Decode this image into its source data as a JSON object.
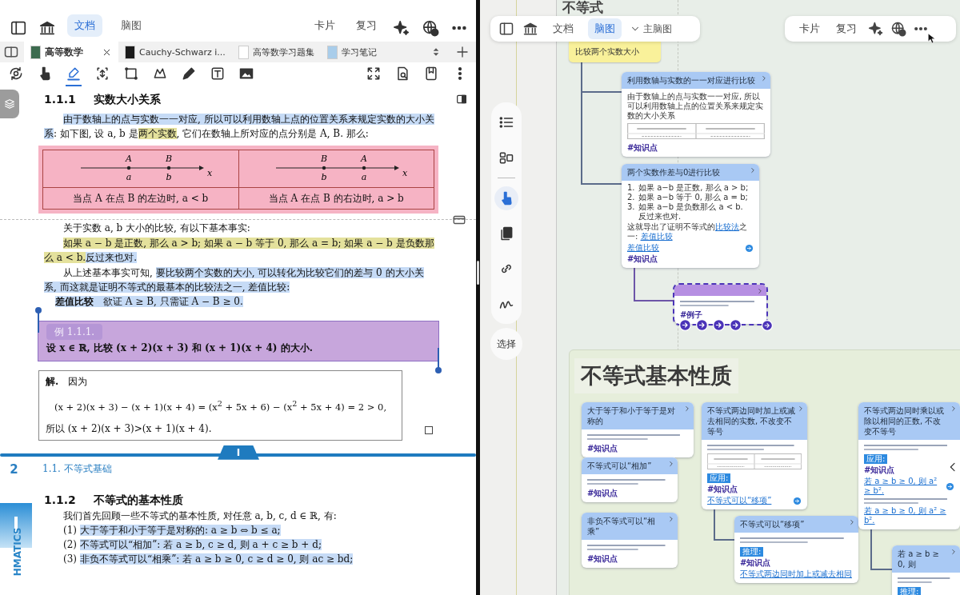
{
  "document_pane": {
    "toolbar": {
      "view_tabs": [
        {
          "label": "文档",
          "selected": true
        },
        {
          "label": "脑图",
          "selected": false
        }
      ],
      "actions": [
        {
          "label": "卡片"
        },
        {
          "label": "复习"
        }
      ]
    },
    "tabs": [
      {
        "label": "高等数学",
        "selected": true,
        "color": "#3d6b4f"
      },
      {
        "label": "Cauchy-Schwarz i...",
        "selected": false,
        "color": "#1a1a1a"
      },
      {
        "label": "高等数学习题集",
        "selected": false,
        "color": "#ffffff"
      },
      {
        "label": "学习笔记",
        "selected": false,
        "color": "#a9cdea"
      }
    ],
    "tools": [
      {
        "kind": "rotate",
        "selected": false
      },
      {
        "kind": "hand",
        "selected": false
      },
      {
        "kind": "highlighter",
        "selected": true
      },
      {
        "kind": "resize",
        "selected": false
      },
      {
        "kind": "rectangle",
        "selected": false
      },
      {
        "kind": "lasso",
        "selected": false
      },
      {
        "kind": "pencil",
        "selected": false
      },
      {
        "kind": "textbox",
        "selected": false
      },
      {
        "kind": "image",
        "selected": false
      },
      {
        "kind": "expand",
        "selected": false
      },
      {
        "kind": "doc_search",
        "selected": false
      },
      {
        "kind": "bookmark",
        "selected": false
      },
      {
        "kind": "more",
        "selected": false
      }
    ],
    "page": {
      "blocks": [
        {
          "kind": "heading",
          "number": "1.1.1",
          "text": "实数大小关系"
        },
        {
          "kind": "paragraph",
          "segments": [
            {
              "text": "由于数轴上的点与实数一一对应, 所以可以利用数轴上点的位置关系来规定实数的大小关系",
              "highlighted": true,
              "color": "#c6dbf6"
            },
            {
              "text": ": 如下图, 设 a, b 是",
              "highlighted": false
            },
            {
              "text": "两个实数",
              "highlighted": true,
              "color": "#e4e19c"
            },
            {
              "text": ", 它们在数轴上所对应的点分别是 A, B. 那么:",
              "highlighted": false
            }
          ]
        },
        {
          "kind": "figure",
          "highlighted": true,
          "color": "#f6b3c4",
          "cells": [
            {
              "top_labels": [
                "A",
                "B"
              ],
              "bottom_labels": [
                "a",
                "b"
              ],
              "axis_label": "x",
              "caption": "当点 A 在点 B 的左边时, a < b"
            },
            {
              "top_labels": [
                "B",
                "A"
              ],
              "bottom_labels": [
                "b",
                "a"
              ],
              "axis_label": "x",
              "caption": "当点 A 在点 B 的右边时, a > b"
            }
          ]
        },
        {
          "kind": "paragraph",
          "segments": [
            {
              "text": "关于实数 a, b 大小的比较, 有以下基本事实:",
              "highlighted": false
            }
          ]
        },
        {
          "kind": "paragraph",
          "segments": [
            {
              "text": "如果 a − b 是正数, 那么 a > b; 如果 a − b 等于 0, 那么 a = b; 如果 a − b 是负数那么 a < b.",
              "highlighted": true,
              "color": "#e4e19c"
            },
            {
              "text": "反过来也对.",
              "highlighted": true,
              "color": "#c6dbf6"
            }
          ]
        },
        {
          "kind": "paragraph",
          "segments": [
            {
              "text": "从上述基本事实可知, ",
              "highlighted": false
            },
            {
              "text": "要比较两个实数的大小, 可以转化为比较它们的差与 0 的大小关系, 而这就是证明不等式的最基本的比较法之一, 差值比较:",
              "highlighted": true,
              "color": "#c6dbf6"
            }
          ]
        },
        {
          "kind": "definition",
          "segments": [
            {
              "text": "**差值比较**　欲证 A ≥ B, 只需证 A − B ≥ 0.",
              "highlighted": true,
              "color": "#c6dbf6"
            }
          ]
        },
        {
          "kind": "example",
          "highlighted": true,
          "color": "#c7a6dc",
          "selected": true,
          "label": "例 1.1.1.",
          "text": "设 x ∈ ℝ, 比较 (x + 2)(x + 3) 和 (x + 1)(x + 4) 的大小."
        },
        {
          "kind": "solution",
          "lead": "**解.**　因为",
          "equation": "(x + 2)(x + 3) − (x + 1)(x + 4) = (x$^{2}$ + 5x + 6) − (x$^{2}$ + 5x + 4) = 2 > 0,",
          "conclusion": "所以 (x + 2)(x + 3)>(x + 1)(x + 4)."
        },
        {
          "kind": "page_break",
          "chapter_tab": "I",
          "page_number": "2",
          "running_head": "1.1.  不等式基础",
          "side_tab": "HMATICS"
        },
        {
          "kind": "heading",
          "number": "1.1.2",
          "text": "不等式的基本性质"
        },
        {
          "kind": "paragraph",
          "segments": [
            {
              "text": "我们首先回顾一些不等式的基本性质, 对任意 a, b, c, d ∈ ℝ, 有:",
              "highlighted": false
            }
          ]
        },
        {
          "kind": "list_item",
          "number": "(1)",
          "segments": [
            {
              "text": "大于等于和小于等于是对称的: a ≥ b ⇔ b ≤ a;",
              "highlighted": true,
              "color": "#c6dbf6"
            }
          ]
        },
        {
          "kind": "list_item",
          "number": "(2)",
          "segments": [
            {
              "text": "不等式可以“相加”: 若 a ≥ b, c ≥ d, 则 a + c ≥ b + d;",
              "highlighted": true,
              "color": "#c6dbf6"
            }
          ]
        },
        {
          "kind": "list_item",
          "number": "(3)",
          "segments": [
            {
              "text": "非负不等式可以“相乘”: 若 a ≥ b ≥ 0, c ≥ d ≥ 0, 则 ac ≥ bd;",
              "highlighted": true,
              "color": "#c6dbf6"
            }
          ]
        }
      ]
    }
  },
  "mindmap_pane": {
    "toolbar": {
      "view_tabs": [
        {
          "label": "文档",
          "selected": false
        },
        {
          "label": "脑图",
          "selected": true
        }
      ],
      "map_selector": "主脑图",
      "actions": [
        {
          "label": "卡片"
        },
        {
          "label": "复习"
        }
      ]
    },
    "side_tools": [
      {
        "kind": "outline",
        "selected": false
      },
      {
        "kind": "layout",
        "selected": false
      },
      {
        "kind": "pointer",
        "selected": true
      },
      {
        "kind": "pages",
        "selected": false
      },
      {
        "kind": "link",
        "selected": false
      },
      {
        "kind": "draw",
        "selected": false
      }
    ],
    "select_button": "选择",
    "title": "不等式",
    "root_node": "比较两个实数大小",
    "cards": [
      {
        "kind": "knowledge",
        "selected": false,
        "title": "利用数轴与实数的一一对应进行比较",
        "body": [
          {
            "kind": "text",
            "text": "由于数轴上的点与实数一一对应, 所以可以利用数轴上点的位置关系来规定实数的大小关系"
          },
          {
            "kind": "figure"
          },
          {
            "kind": "tag",
            "text": "#知识点"
          }
        ]
      },
      {
        "kind": "knowledge",
        "selected": false,
        "title": "两个实数作差与0进行比较",
        "body": [
          {
            "kind": "list",
            "items": [
              {
                "number": "1.",
                "text": "如果 a−b 是正数, 那么 a > b;"
              },
              {
                "number": "2.",
                "text": "如果 a−b 等于 0, 那么 a = b;"
              },
              {
                "number": "3.",
                "text": "如果 a−b 是负数那么 a < b."
              },
              {
                "text": "反过来也对."
              }
            ]
          },
          {
            "kind": "parts",
            "parts": [
              {
                "text": "这就导出了证明不等式的",
                "link": false
              },
              {
                "text": "比较法",
                "link": true
              },
              {
                "text": "之一: ",
                "link": false
              },
              {
                "text": "差值比较",
                "link": true
              }
            ]
          },
          {
            "kind": "link",
            "text": "差值比较",
            "action": true
          },
          {
            "kind": "tag",
            "text": "#知识点"
          }
        ]
      },
      {
        "kind": "example",
        "selected": true,
        "body": [
          {
            "kind": "illegible"
          },
          {
            "kind": "tag",
            "text": "#例子"
          }
        ]
      }
    ],
    "group": {
      "title": "不等式基本性质",
      "cards": [
        {
          "kind": "knowledge",
          "selected": false,
          "title": "大于等于和小于等于是对称的",
          "body": [
            {
              "kind": "illegible"
            },
            {
              "kind": "tag",
              "text": "#知识点"
            }
          ]
        },
        {
          "kind": "knowledge",
          "selected": false,
          "title": "不等式可以“相加”",
          "body": [
            {
              "kind": "illegible"
            },
            {
              "kind": "tag",
              "text": "#知识点"
            }
          ]
        },
        {
          "kind": "knowledge",
          "selected": false,
          "title": "非负不等式可以“相乘”",
          "body": [
            {
              "kind": "illegible"
            },
            {
              "kind": "tag",
              "text": "#知识点"
            }
          ]
        },
        {
          "kind": "knowledge",
          "selected": false,
          "title": "不等式两边同时加上或减去相同的实数, 不改变不等号",
          "body": [
            {
              "kind": "illegible"
            },
            {
              "kind": "figure"
            },
            {
              "kind": "badge",
              "text": "应用:"
            },
            {
              "kind": "tag",
              "text": "#知识点"
            },
            {
              "kind": "link",
              "text": "不等式可以“移项”",
              "action": true
            }
          ]
        },
        {
          "kind": "knowledge",
          "selected": false,
          "title": "不等式可以“移项”",
          "body": [
            {
              "kind": "illegible"
            },
            {
              "kind": "badge",
              "text": "推理:"
            },
            {
              "kind": "tag",
              "text": "#知识点"
            },
            {
              "kind": "link",
              "text": "不等式两边同时加上或减去相同",
              "action": false
            }
          ]
        },
        {
          "kind": "knowledge",
          "selected": false,
          "title": "不等式两边同时乘以或除以相同的正数, 不改变不等号",
          "body": [
            {
              "kind": "illegible"
            },
            {
              "kind": "badge",
              "text": "应用:"
            },
            {
              "kind": "tag",
              "text": "#知识点"
            },
            {
              "kind": "link",
              "text": "若 a ≥ b ≥ 0, 则 a² ≥ b².",
              "action": true
            },
            {
              "kind": "illegible"
            },
            {
              "kind": "link",
              "text": "若 a ≥ b ≥ 0, 则 a² ≥ b².",
              "action": false
            }
          ]
        },
        {
          "kind": "knowledge",
          "selected": false,
          "title": "若 a ≥ b ≥ 0, 则",
          "body": [
            {
              "kind": "illegible"
            },
            {
              "kind": "badge",
              "text": "推理:"
            }
          ]
        }
      ]
    }
  }
}
